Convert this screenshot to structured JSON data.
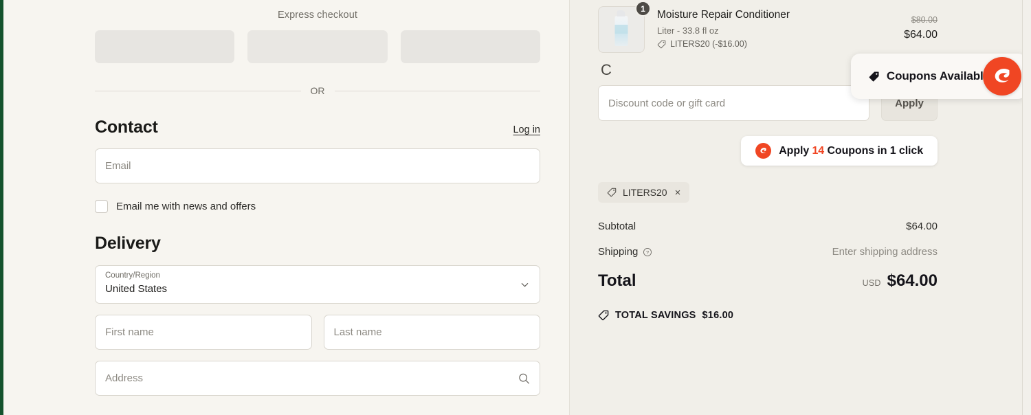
{
  "left": {
    "express_checkout_label": "Express checkout",
    "express_buttons": [
      "",
      "",
      ""
    ],
    "or_divider": "OR",
    "contact": {
      "title": "Contact",
      "login_label": "Log in",
      "email_placeholder": "Email",
      "newsletter_label": "Email me with news and offers"
    },
    "delivery": {
      "title": "Delivery",
      "country_label": "Country/Region",
      "country_value": "United States",
      "first_name_placeholder": "First name",
      "last_name_placeholder": "Last name",
      "address_placeholder": "Address"
    }
  },
  "right": {
    "cart_item": {
      "quantity": "1",
      "name": "Moisture Repair Conditioner",
      "variant": "Liter - 33.8 fl oz",
      "discount_text": "LITERS20 (-$16.00)",
      "price_original": "$80.00",
      "price_current": "$64.00"
    },
    "stray_text": "C",
    "discount": {
      "placeholder": "Discount code or gift card",
      "apply_label": "Apply"
    },
    "oneclick": {
      "prefix": "Apply ",
      "count": "14",
      "suffix": " Coupons in 1 click"
    },
    "applied_code": {
      "label": "LITERS20",
      "remove": "×"
    },
    "totals": {
      "subtotal_label": "Subtotal",
      "subtotal_value": "$64.00",
      "shipping_label": "Shipping",
      "shipping_value": "Enter shipping address",
      "total_label": "Total",
      "total_currency": "USD",
      "total_value": "$64.00",
      "savings_label": "TOTAL SAVINGS",
      "savings_value": "$16.00"
    },
    "coupon_widget": {
      "label": "Coupons Available"
    }
  },
  "colors": {
    "brand_red": "#f04623",
    "left_bg": "#f7f5f0",
    "right_bg": "#f1efe9",
    "window_edge": "#14532d"
  }
}
